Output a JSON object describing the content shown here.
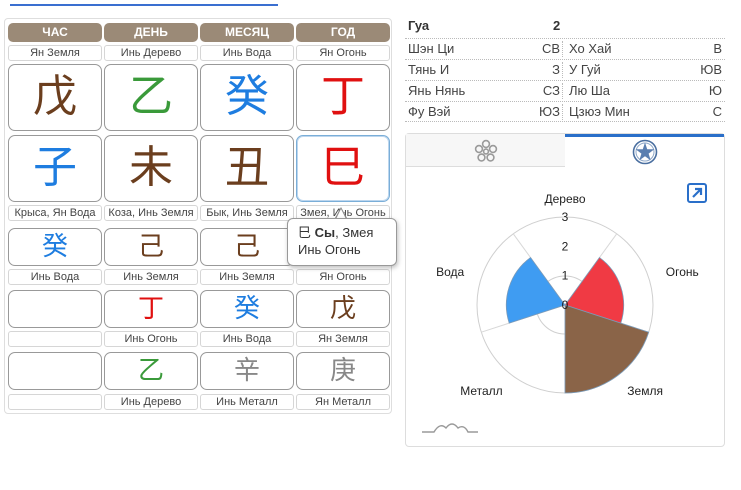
{
  "pillars": {
    "headers": [
      "ЧАС",
      "ДЕНЬ",
      "МЕСЯЦ",
      "ГОД"
    ],
    "stem_labels": [
      "Ян Земля",
      "Инь Дерево",
      "Инь Вода",
      "Ян Огонь"
    ],
    "stems": [
      {
        "char": "戊",
        "element": "earth"
      },
      {
        "char": "乙",
        "element": "wood"
      },
      {
        "char": "癸",
        "element": "water"
      },
      {
        "char": "丁",
        "element": "fire"
      }
    ],
    "branches": [
      {
        "char": "子",
        "element": "water"
      },
      {
        "char": "未",
        "element": "earth"
      },
      {
        "char": "丑",
        "element": "earth"
      },
      {
        "char": "巳",
        "element": "fire"
      }
    ],
    "branch_labels": [
      "Крыса, Ян Вода",
      "Коза, Инь Земля",
      "Бык, Инь Земля",
      "Змея, Инь Огонь"
    ],
    "hidden": [
      {
        "chars": [
          {
            "char": "癸",
            "element": "water"
          },
          {
            "char": "",
            "element": ""
          },
          {
            "char": "",
            "element": ""
          }
        ],
        "labels": [
          "Инь Вода",
          "",
          ""
        ]
      },
      {
        "chars": [
          {
            "char": "己",
            "element": "earth"
          },
          {
            "char": "丁",
            "element": "fire"
          },
          {
            "char": "乙",
            "element": "wood"
          }
        ],
        "labels": [
          "Инь Земля",
          "Инь Огонь",
          "Инь Дерево"
        ]
      },
      {
        "chars": [
          {
            "char": "己",
            "element": "earth"
          },
          {
            "char": "癸",
            "element": "water"
          },
          {
            "char": "辛",
            "element": "metal"
          }
        ],
        "labels": [
          "Инь Земля",
          "Инь Вода",
          "Инь Металл"
        ]
      },
      {
        "chars": [
          {
            "char": "丙",
            "element": "fire"
          },
          {
            "char": "戊",
            "element": "earth"
          },
          {
            "char": "庚",
            "element": "metal"
          }
        ],
        "labels": [
          "Ян Огонь",
          "Ян Земля",
          "Ян Металл"
        ]
      }
    ]
  },
  "tooltip": {
    "char": "巳",
    "name": "Сы",
    "line1_rest": ", Змея",
    "line2": "Инь Огонь"
  },
  "gua": {
    "label": "Гуа",
    "value": "2"
  },
  "stars": [
    {
      "n1": "Шэн Ци",
      "v1": "СВ",
      "n2": "Хо Хай",
      "v2": "В"
    },
    {
      "n1": "Тянь И",
      "v1": "З",
      "n2": "У Гуй",
      "v2": "ЮВ"
    },
    {
      "n1": "Янь Нянь",
      "v1": "СЗ",
      "n2": "Лю Ша",
      "v2": "Ю"
    },
    {
      "n1": "Фу Вэй",
      "v1": "ЮЗ",
      "n2": "Цзюэ Мин",
      "v2": "С"
    }
  ],
  "colors": {
    "earth": "#6b3e1e",
    "wood": "#3a9a3a",
    "water": "#1e7de0",
    "fire": "#e01010",
    "metal": "#888888",
    "header_bg": "#9b8a77",
    "accent": "#2a6fc9"
  },
  "icons": {
    "tab1": "flower-pentagon-icon",
    "tab2": "compass-star-icon",
    "expand": "expand-arrow-icon",
    "mini_chart": "mountain-wave-icon"
  },
  "chart_data": {
    "type": "polar-area",
    "categories": [
      "Дерево",
      "Огонь",
      "Земля",
      "Металл",
      "Вода"
    ],
    "values": [
      0,
      2,
      3,
      0,
      2
    ],
    "series_colors": [
      "#3a9a3a",
      "#f03a44",
      "#8a6448",
      "#9a9a9a",
      "#3f9cf2"
    ],
    "r_ticks": [
      "0",
      "1",
      "2",
      "3"
    ],
    "rlim": [
      0,
      3
    ]
  }
}
